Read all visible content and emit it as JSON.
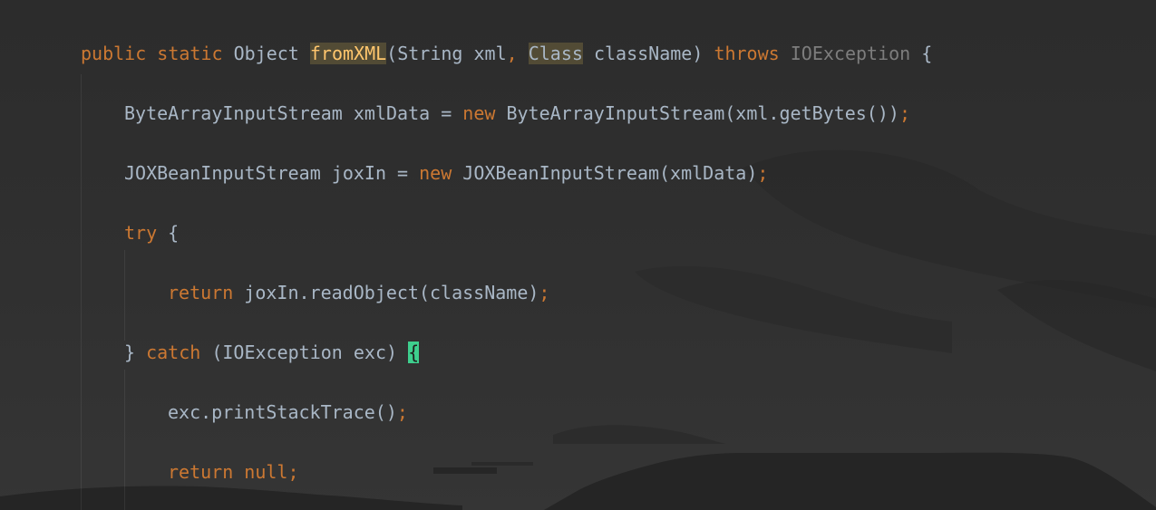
{
  "editor": {
    "lines": [
      {
        "tokens": [
          {
            "text": "public",
            "kind": "kw"
          },
          {
            "text": " ",
            "kind": "id"
          },
          {
            "text": "static",
            "kind": "kw"
          },
          {
            "text": " Object ",
            "kind": "id"
          },
          {
            "text": "fromXML",
            "kind": "fn",
            "highlight": true
          },
          {
            "text": "(String xml",
            "kind": "id"
          },
          {
            "text": ",",
            "kind": "punc"
          },
          {
            "text": " ",
            "kind": "id"
          },
          {
            "text": "Class",
            "kind": "id",
            "highlight": true
          },
          {
            "text": " className) ",
            "kind": "id"
          },
          {
            "text": "throws",
            "kind": "kw"
          },
          {
            "text": " ",
            "kind": "id"
          },
          {
            "text": "IOException",
            "kind": "dim"
          },
          {
            "text": " {",
            "kind": "id"
          }
        ]
      },
      {
        "tokens": [
          {
            "text": "ByteArrayInputStream xmlData = ",
            "kind": "id"
          },
          {
            "text": "new",
            "kind": "kw"
          },
          {
            "text": " ByteArrayInputStream(xml.getBytes())",
            "kind": "id"
          },
          {
            "text": ";",
            "kind": "punc"
          }
        ]
      },
      {
        "tokens": [
          {
            "text": "JOXBeanInputStream joxIn = ",
            "kind": "id"
          },
          {
            "text": "new",
            "kind": "kw"
          },
          {
            "text": " JOXBeanInputStream(xmlData)",
            "kind": "id"
          },
          {
            "text": ";",
            "kind": "punc"
          }
        ]
      },
      {
        "tokens": [
          {
            "text": "try",
            "kind": "kw"
          },
          {
            "text": " {",
            "kind": "id"
          }
        ]
      },
      {
        "tokens": [
          {
            "text": "return",
            "kind": "kw"
          },
          {
            "text": " joxIn.readObject(className)",
            "kind": "id"
          },
          {
            "text": ";",
            "kind": "punc"
          }
        ]
      },
      {
        "tokens": [
          {
            "text": "} ",
            "kind": "id"
          },
          {
            "text": "catch",
            "kind": "kw"
          },
          {
            "text": " (IOException exc) ",
            "kind": "id"
          },
          {
            "text": "{",
            "kind": "id",
            "bracket": true
          }
        ]
      },
      {
        "tokens": [
          {
            "text": "exc.printStackTrace()",
            "kind": "id"
          },
          {
            "text": ";",
            "kind": "punc"
          }
        ]
      },
      {
        "tokens": [
          {
            "text": "return",
            "kind": "kw"
          },
          {
            "text": " ",
            "kind": "id"
          },
          {
            "text": "null",
            "kind": "kw"
          },
          {
            "text": ";",
            "kind": "punc"
          }
        ]
      }
    ]
  }
}
